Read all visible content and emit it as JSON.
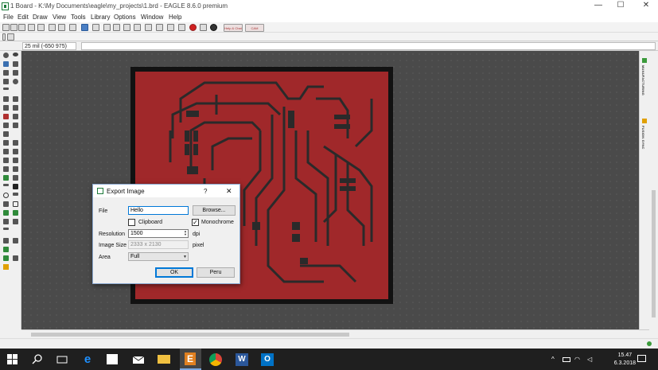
{
  "window": {
    "title": "1 Board - K:\\My Documents\\eagle\\my_projects\\1.brd - EAGLE 8.6.0 premium",
    "controls": {
      "minimize": "—",
      "maximize": "☐",
      "close": "✕"
    }
  },
  "menu": [
    "File",
    "Edit",
    "Draw",
    "View",
    "Tools",
    "Library",
    "Options",
    "Window",
    "Help"
  ],
  "toolbar": {
    "badge1": "Help & Chat",
    "badge2": "CAM"
  },
  "coord_display": "25 mil (-650 975)",
  "right_panels": [
    "MANUFACTURING",
    "FUSION SYNC"
  ],
  "colors": {
    "board": "#a0282a",
    "trace": "#2a2a2a",
    "canvas_bg": "#4a4a4a",
    "accent": "#0078d7",
    "taskbar": "#1f1f1f"
  },
  "dialog": {
    "title": "Export Image",
    "help": "?",
    "close": "✕",
    "file_label": "File",
    "file_value": "Hello",
    "browse": "Browse...",
    "clipboard_label": "Clipboard",
    "clipboard_checked": false,
    "monochrome_label": "Monochrome",
    "monochrome_checked": true,
    "check_mark": "✓",
    "resolution_label": "Resolution",
    "resolution_value": "1500",
    "resolution_unit": "dpi",
    "imagesize_label": "Image Size",
    "imagesize_value": "2333 x 2130",
    "imagesize_unit": "pixel",
    "area_label": "Area",
    "area_value": "Full",
    "ok": "OK",
    "cancel": "Peru"
  },
  "taskbar": {
    "time": "15.47",
    "date": "6.3.2018",
    "apps": [
      "start",
      "search",
      "task-view",
      "edge",
      "store",
      "mail",
      "file-explorer",
      "eagle",
      "chrome",
      "word",
      "outlook"
    ]
  }
}
